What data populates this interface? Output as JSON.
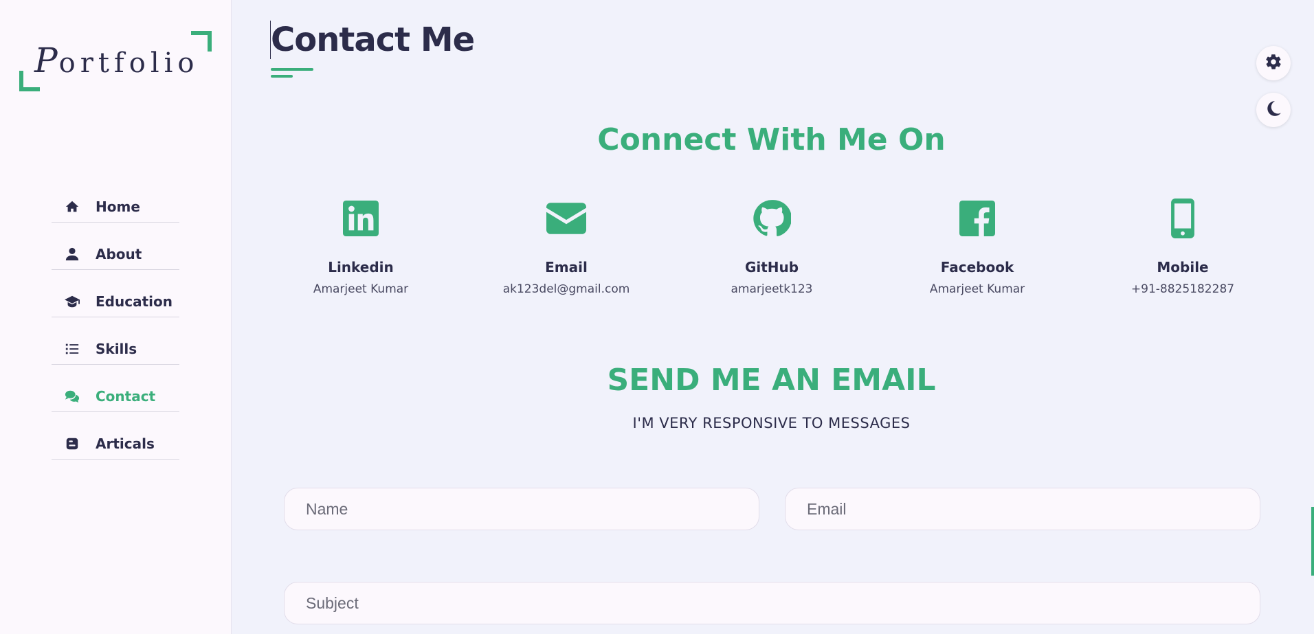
{
  "sidebar": {
    "logo": {
      "cap": "P",
      "rest": "ortfolio"
    },
    "items": [
      {
        "label": "Home",
        "icon": "home-icon"
      },
      {
        "label": "About",
        "icon": "user-icon"
      },
      {
        "label": "Education",
        "icon": "graduation-cap-icon"
      },
      {
        "label": "Skills",
        "icon": "list-icon"
      },
      {
        "label": "Contact",
        "icon": "comments-icon",
        "active": true
      },
      {
        "label": "Articals",
        "icon": "blogger-icon"
      }
    ]
  },
  "main": {
    "page_title": "Contact Me",
    "connect_title": "Connect With Me On",
    "contacts": [
      {
        "label": "Linkedin",
        "value": "Amarjeet Kumar",
        "icon": "linkedin-icon"
      },
      {
        "label": "Email",
        "value": "ak123del@gmail.com",
        "icon": "envelope-icon"
      },
      {
        "label": "GitHub",
        "value": "amarjeetk123",
        "icon": "github-icon"
      },
      {
        "label": "Facebook",
        "value": "Amarjeet Kumar",
        "icon": "facebook-icon"
      },
      {
        "label": "Mobile",
        "value": "+91-8825182287",
        "icon": "mobile-icon"
      }
    ],
    "email_title": "SEND ME AN EMAIL",
    "email_subtitle": "I'M VERY RESPONSIVE TO MESSAGES",
    "form": {
      "name_placeholder": "Name",
      "email_placeholder": "Email",
      "subject_placeholder": "Subject"
    }
  },
  "controls": {
    "settings_icon": "gear-icon",
    "theme_icon": "moon-icon"
  },
  "colors": {
    "accent": "#3aae7b",
    "text": "#2c2c4a",
    "background": "#f1f2fb",
    "sidebar": "#fcf8fd"
  }
}
